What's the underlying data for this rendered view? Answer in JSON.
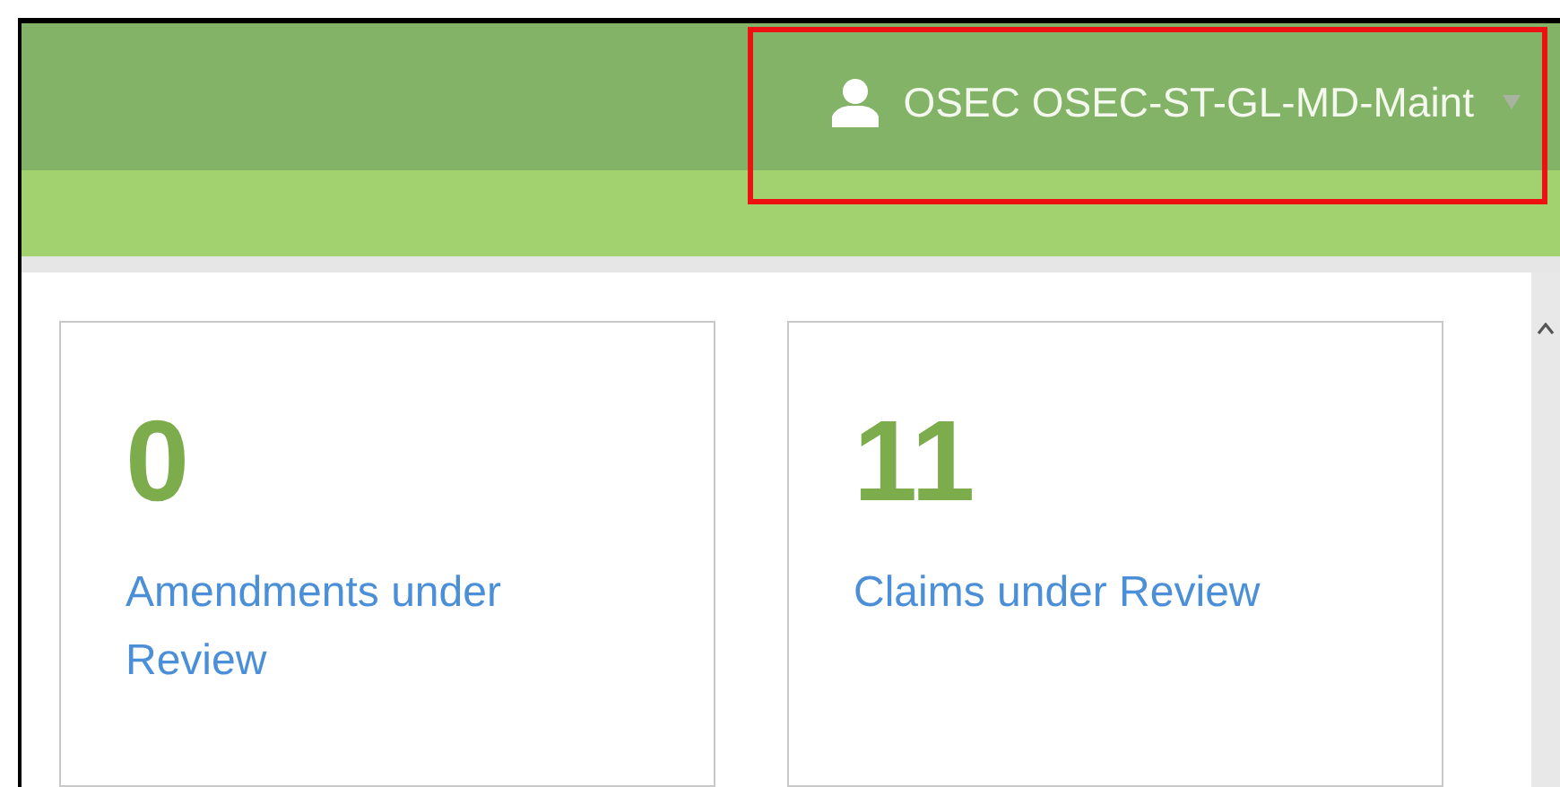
{
  "user_menu": {
    "name": "OSEC OSEC-ST-GL-MD-Maint",
    "highlighted": true
  },
  "cards": [
    {
      "count": "0",
      "label": "Amendments under Review"
    },
    {
      "count": "11",
      "label": "Claims under Review"
    }
  ]
}
